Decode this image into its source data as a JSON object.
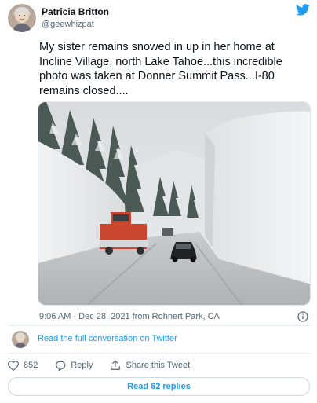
{
  "author": {
    "name": "Patricia Britton",
    "handle": "@geewhizpat"
  },
  "tweet": {
    "text": "My sister remains snowed in up in her home at Incline Village, north Lake Tahoe...this incredible photo was taken at Donner Summit Pass...I-80 remains closed....",
    "timestamp": "9:06 AM · Dec 28, 2021 from Rohnert Park, CA"
  },
  "conversation": {
    "link_label": "Read the full conversation on Twitter"
  },
  "actions": {
    "like_count": "852",
    "reply_label": "Reply",
    "share_label": "Share this Tweet"
  },
  "replies_button": {
    "label": "Read 62 replies"
  },
  "colors": {
    "accent": "#1d9bf0",
    "text": "#0f1419",
    "muted": "#536471"
  },
  "icons": [
    "twitter-bird-icon",
    "info-icon",
    "heart-icon",
    "reply-icon",
    "share-icon"
  ]
}
